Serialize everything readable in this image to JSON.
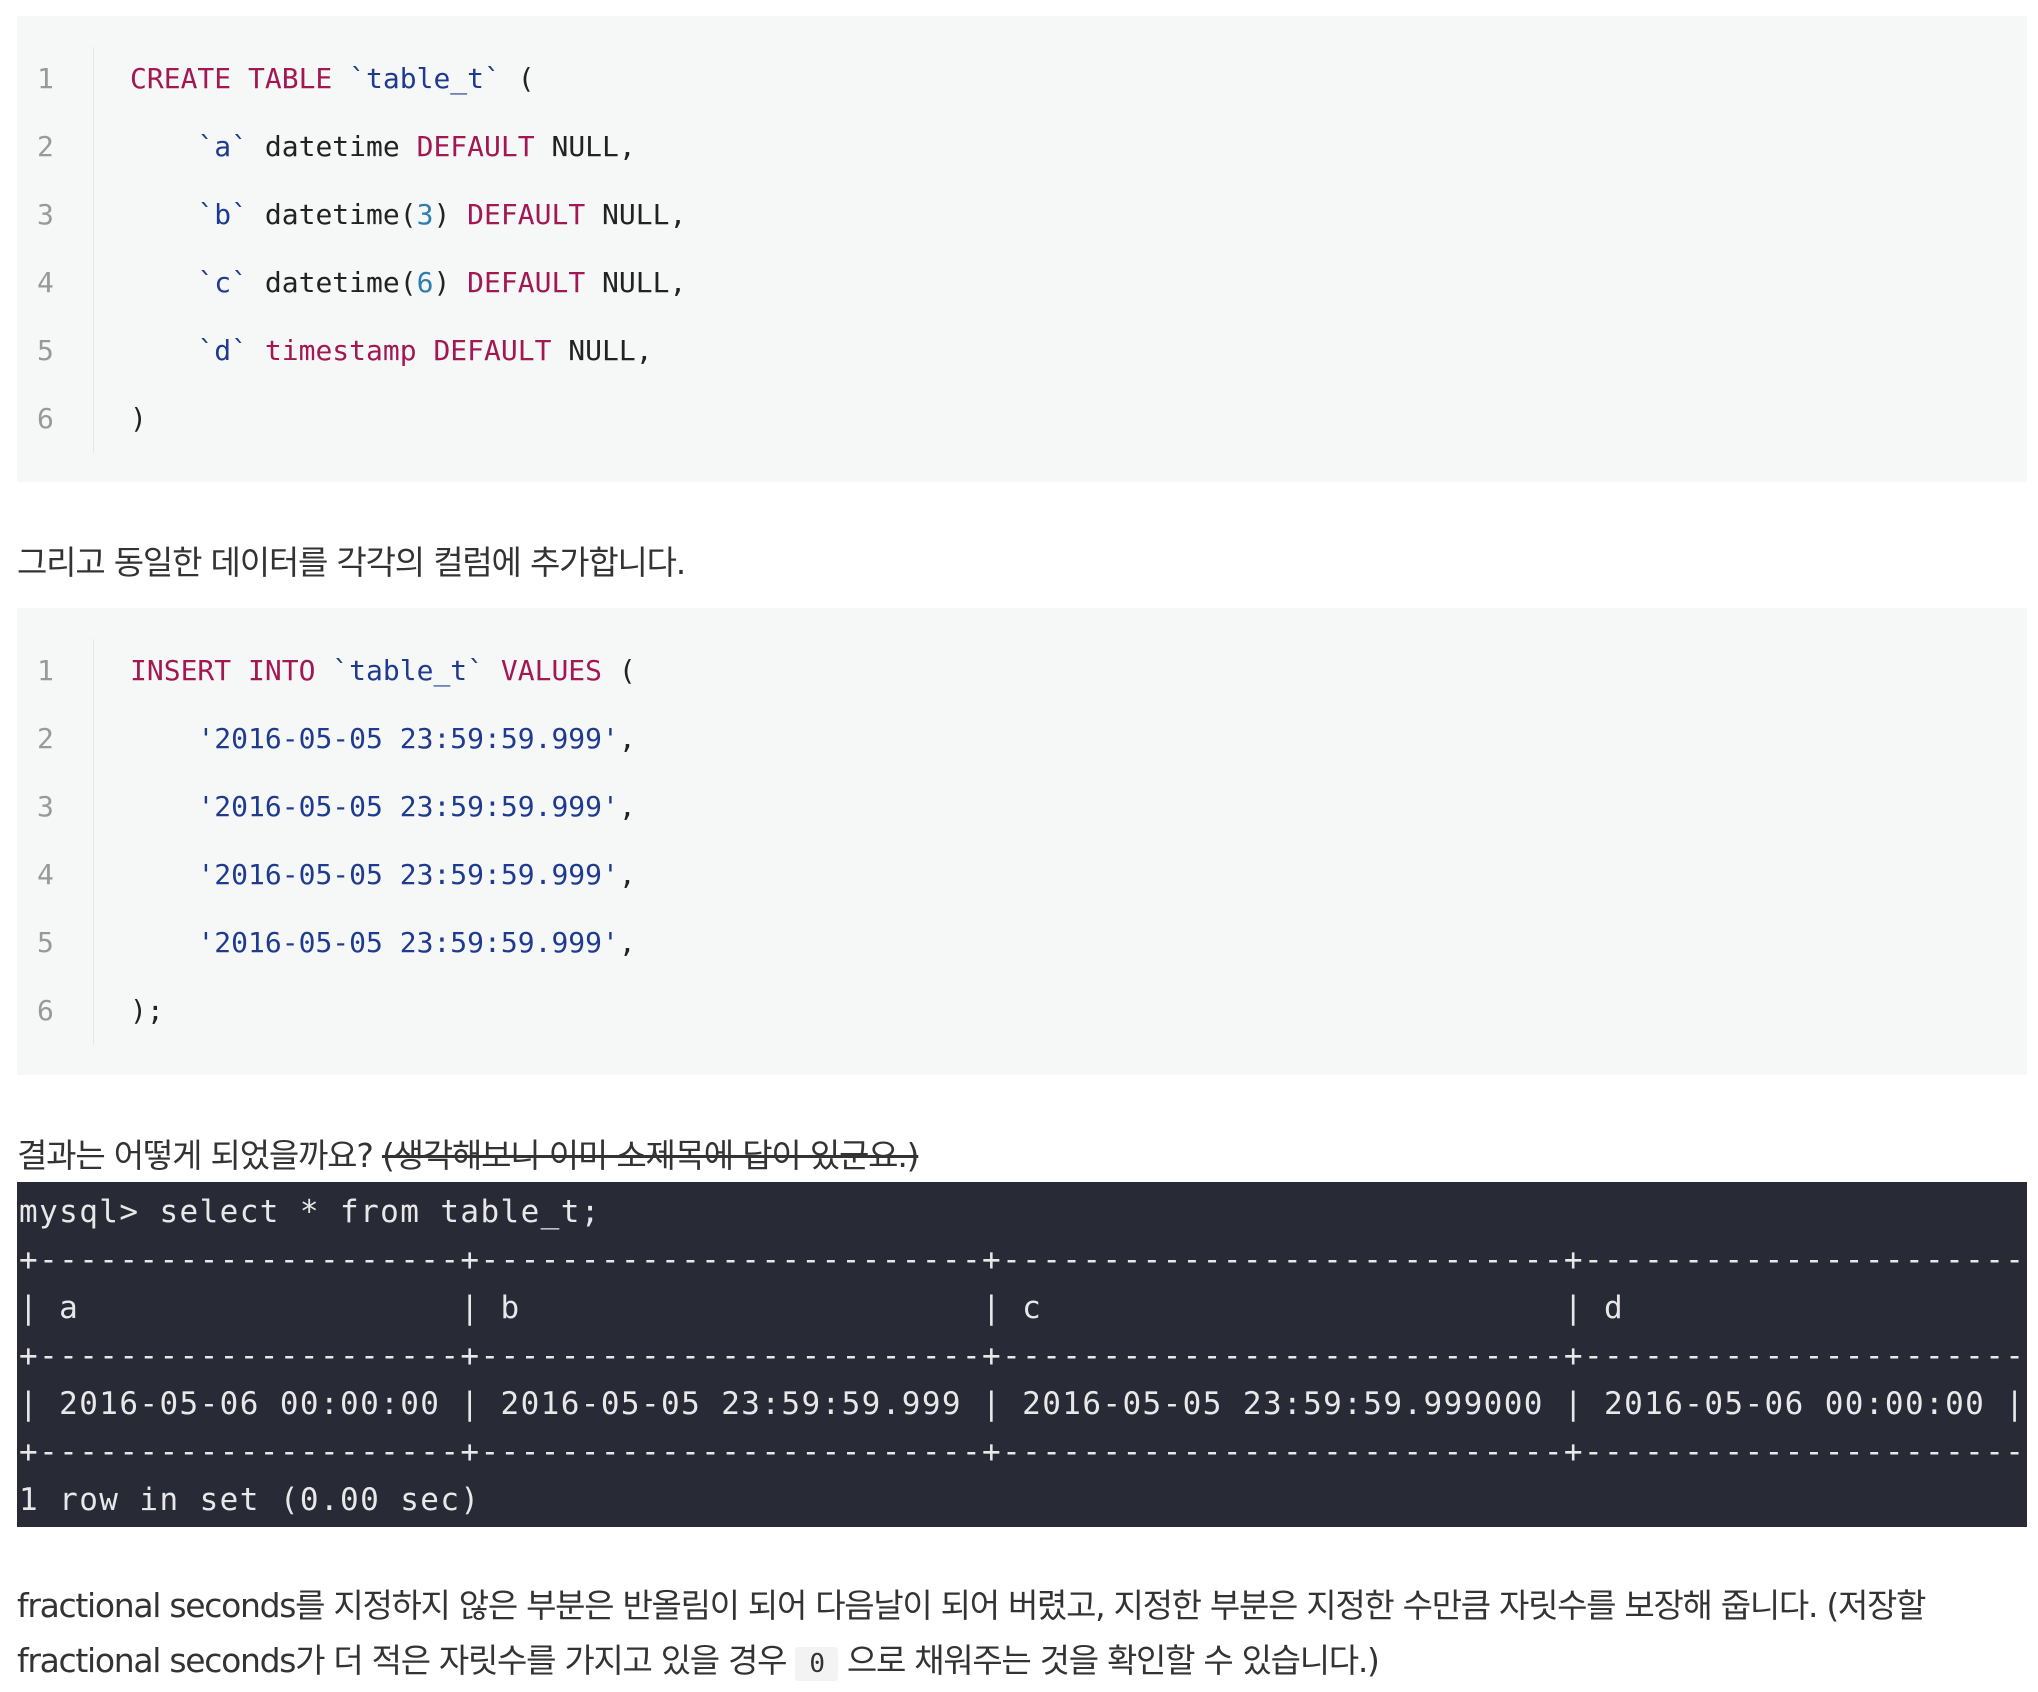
{
  "code_block_1": {
    "lines": [
      {
        "num": "1",
        "tokens": [
          {
            "t": "kw",
            "v": "CREATE TABLE "
          },
          {
            "t": "str",
            "v": "`table_t`"
          },
          {
            "t": "plain",
            "v": " ("
          }
        ]
      },
      {
        "num": "2",
        "tokens": [
          {
            "t": "plain",
            "v": "    "
          },
          {
            "t": "str",
            "v": "`a`"
          },
          {
            "t": "plain",
            "v": " datetime "
          },
          {
            "t": "kw",
            "v": "DEFAULT"
          },
          {
            "t": "plain",
            "v": " NULL,"
          }
        ]
      },
      {
        "num": "3",
        "tokens": [
          {
            "t": "plain",
            "v": "    "
          },
          {
            "t": "str",
            "v": "`b`"
          },
          {
            "t": "plain",
            "v": " datetime("
          },
          {
            "t": "num",
            "v": "3"
          },
          {
            "t": "plain",
            "v": ") "
          },
          {
            "t": "kw",
            "v": "DEFAULT"
          },
          {
            "t": "plain",
            "v": " NULL,"
          }
        ]
      },
      {
        "num": "4",
        "tokens": [
          {
            "t": "plain",
            "v": "    "
          },
          {
            "t": "str",
            "v": "`c`"
          },
          {
            "t": "plain",
            "v": " datetime("
          },
          {
            "t": "num",
            "v": "6"
          },
          {
            "t": "plain",
            "v": ") "
          },
          {
            "t": "kw",
            "v": "DEFAULT"
          },
          {
            "t": "plain",
            "v": " NULL,"
          }
        ]
      },
      {
        "num": "5",
        "tokens": [
          {
            "t": "plain",
            "v": "    "
          },
          {
            "t": "str",
            "v": "`d`"
          },
          {
            "t": "plain",
            "v": " "
          },
          {
            "t": "kw",
            "v": "timestamp DEFAULT"
          },
          {
            "t": "plain",
            "v": " NULL,"
          }
        ]
      },
      {
        "num": "6",
        "tokens": [
          {
            "t": "plain",
            "v": ")"
          }
        ]
      }
    ]
  },
  "paragraph_1": "그리고 동일한 데이터를 각각의 컬럼에 추가합니다.",
  "code_block_2": {
    "lines": [
      {
        "num": "1",
        "tokens": [
          {
            "t": "kw",
            "v": "INSERT INTO "
          },
          {
            "t": "str",
            "v": "`table_t`"
          },
          {
            "t": "plain",
            "v": " "
          },
          {
            "t": "kw",
            "v": "VALUES"
          },
          {
            "t": "plain",
            "v": " ("
          }
        ]
      },
      {
        "num": "2",
        "tokens": [
          {
            "t": "plain",
            "v": "    "
          },
          {
            "t": "str",
            "v": "'2016-05-05 23:59:59.999'"
          },
          {
            "t": "plain",
            "v": ","
          }
        ]
      },
      {
        "num": "3",
        "tokens": [
          {
            "t": "plain",
            "v": "    "
          },
          {
            "t": "str",
            "v": "'2016-05-05 23:59:59.999'"
          },
          {
            "t": "plain",
            "v": ","
          }
        ]
      },
      {
        "num": "4",
        "tokens": [
          {
            "t": "plain",
            "v": "    "
          },
          {
            "t": "str",
            "v": "'2016-05-05 23:59:59.999'"
          },
          {
            "t": "plain",
            "v": ","
          }
        ]
      },
      {
        "num": "5",
        "tokens": [
          {
            "t": "plain",
            "v": "    "
          },
          {
            "t": "str",
            "v": "'2016-05-05 23:59:59.999'"
          },
          {
            "t": "plain",
            "v": ","
          }
        ]
      },
      {
        "num": "6",
        "tokens": [
          {
            "t": "plain",
            "v": ");"
          }
        ]
      }
    ]
  },
  "paragraph_2": {
    "text": "결과는 어떻게 되었을까요? ",
    "strike_text": "(생각해보니 이미 소제목에 답이 있군요.)"
  },
  "terminal": {
    "lines": [
      "mysql> select * from table_t;",
      "+---------------------+-------------------------+----------------------------+-----------------------+",
      "| a                   | b                       | c                          | d                     |",
      "+---------------------+-------------------------+----------------------------+-----------------------+",
      "| 2016-05-06 00:00:00 | 2016-05-05 23:59:59.999 | 2016-05-05 23:59:59.999000 | 2016-05-06 00:00:00 |",
      "+---------------------+-------------------------+----------------------------+-----------------------+",
      "1 row in set (0.00 sec)"
    ]
  },
  "bottom_paragraph": {
    "line1": "fractional seconds를 지정하지 않은 부분은 반올림이 되어 다음날이 되어 버렸고, 지정한 부분은 지정한 수만큼 자릿수를 보장해 줍니다. (저장할",
    "line2_before": "fractional seconds가 더 적은 자릿수를 가지고 있을 경우 ",
    "inline_code": "0",
    "line2_after": " 으로 채워주는 것을 확인할 수 있습니다.)"
  }
}
